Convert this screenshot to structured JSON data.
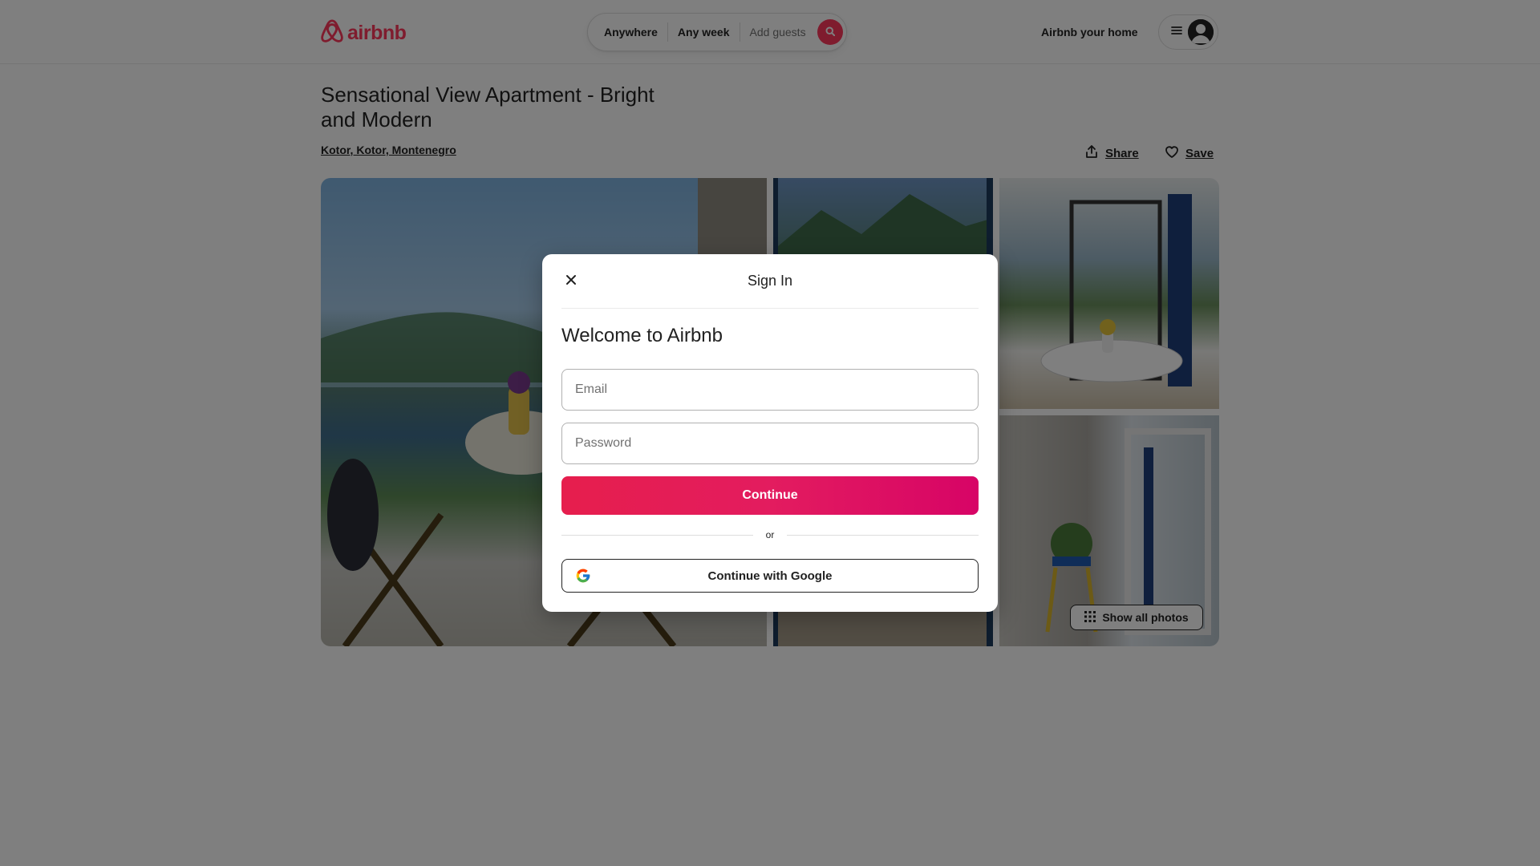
{
  "header": {
    "logo_text": "airbnb",
    "search": {
      "location": "Anywhere",
      "dates": "Any week",
      "guests": "Add guests"
    },
    "host_link": "Airbnb your home"
  },
  "listing": {
    "title": "Sensational View Apartment - Bright and Modern",
    "location": "Kotor, Kotor, Montenegro",
    "share_label": "Share",
    "save_label": "Save",
    "show_all_photos": "Show all photos"
  },
  "modal": {
    "title": "Sign In",
    "welcome": "Welcome to Airbnb",
    "email_placeholder": "Email",
    "password_placeholder": "Password",
    "continue_label": "Continue",
    "divider_text": "or",
    "google_label": "Continue with Google"
  },
  "colors": {
    "brand": "#FF385C",
    "continue_gradient_start": "#E61E4D",
    "continue_gradient_end": "#D70466",
    "overlay": "rgba(0,0,0,0.5)"
  },
  "icons": [
    "airbnb-logo-icon",
    "search-icon",
    "menu-icon",
    "user-avatar-icon",
    "share-icon",
    "heart-icon",
    "grid-icon",
    "close-icon",
    "google-icon"
  ]
}
